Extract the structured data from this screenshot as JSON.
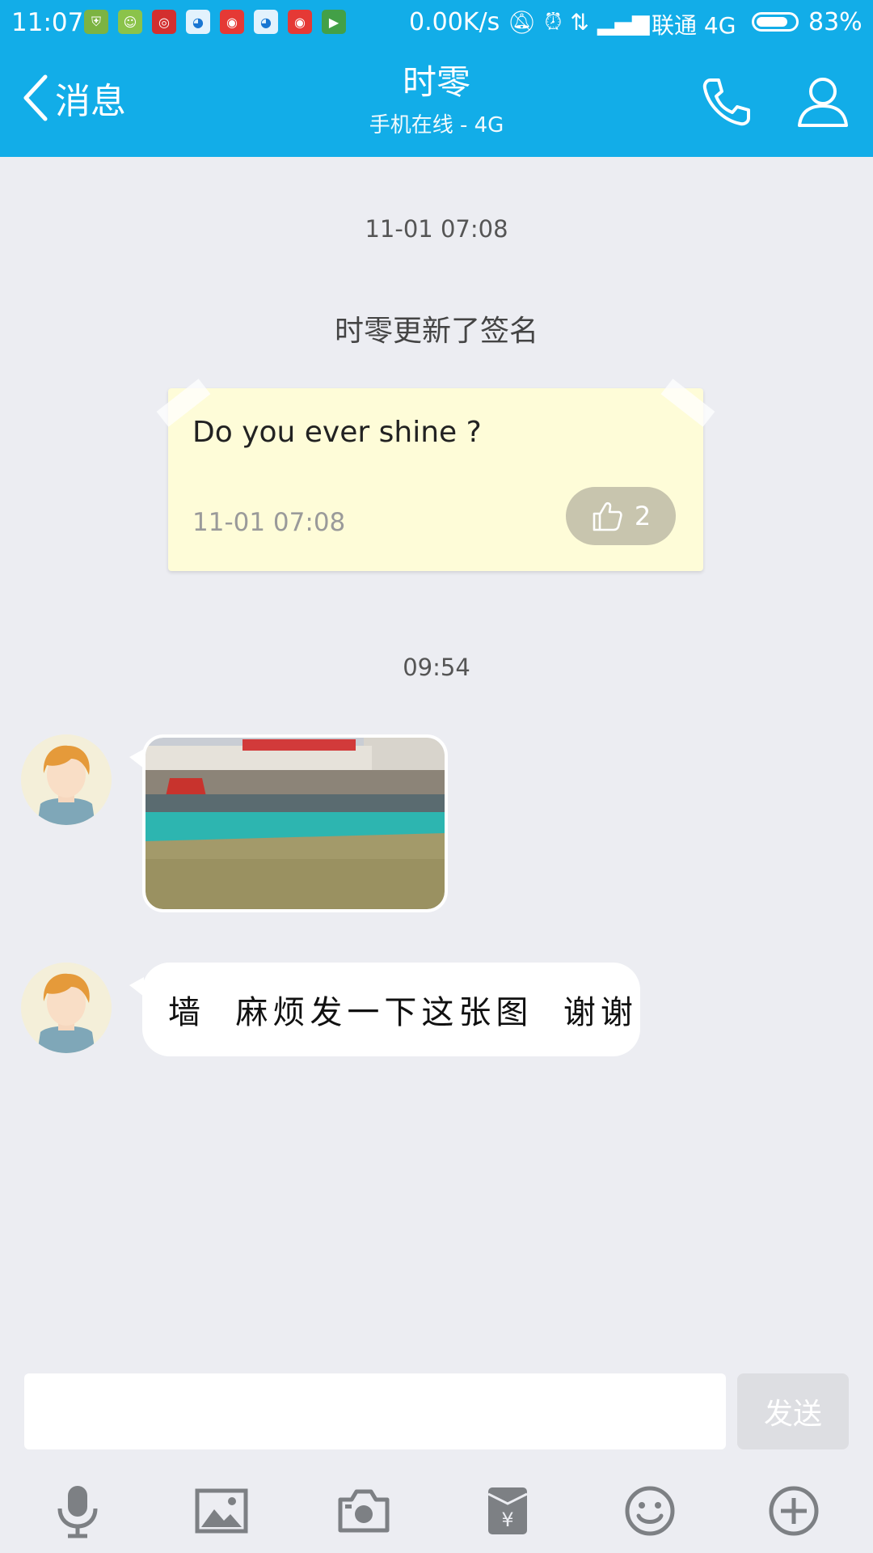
{
  "status_bar": {
    "time": "11:07",
    "net_speed": "0.00K/s",
    "carrier": "联通 4G",
    "battery_percent": "83%",
    "battery_level": 0.83
  },
  "header": {
    "back_label": "消息",
    "title": "时零",
    "subtitle": "手机在线 - 4G"
  },
  "chat": {
    "timestamp_1": "11-01 07:08",
    "system_note": "时零更新了签名",
    "signature": {
      "text": "Do you ever shine ?",
      "time": "11-01 07:08",
      "likes": "2"
    },
    "timestamp_2": "09:54",
    "text_message": "墙  麻烦发一下这张图  谢谢"
  },
  "input_bar": {
    "send_label": "发送",
    "value": ""
  },
  "colors": {
    "accent": "#12ADE8",
    "background": "#ECEDF2",
    "signature_bg": "#FEFCD8"
  },
  "icons": [
    "back-arrow-icon",
    "phone-icon",
    "profile-icon",
    "thumb-up-icon",
    "microphone-icon",
    "image-icon",
    "camera-icon",
    "red-packet-icon",
    "emoji-icon",
    "plus-icon"
  ]
}
